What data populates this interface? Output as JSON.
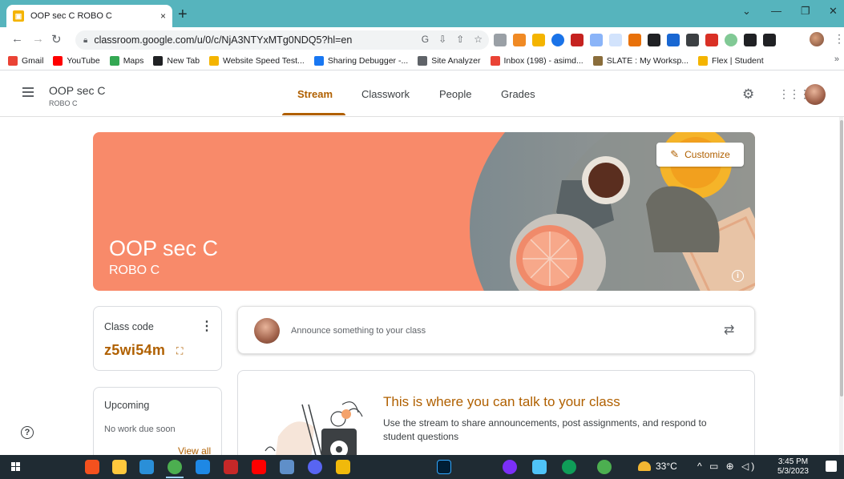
{
  "browser": {
    "tab_title": "OOP sec C ROBO C",
    "tab_close": "×",
    "new_tab": "+",
    "url": "classroom.google.com/u/0/c/NjA3NTYxMTg0NDQ5?hl=en",
    "bookmarks": [
      {
        "label": "Gmail",
        "color": "#ea4335"
      },
      {
        "label": "YouTube",
        "color": "#ff0000"
      },
      {
        "label": "Maps",
        "color": "#34a853"
      },
      {
        "label": "New Tab",
        "color": "#202124"
      },
      {
        "label": "Website Speed Test...",
        "color": "#f4b400"
      },
      {
        "label": "Sharing Debugger -...",
        "color": "#1877f2"
      },
      {
        "label": "Site Analyzer",
        "color": "#5f6368"
      },
      {
        "label": "Inbox (198) - asimd...",
        "color": "#ea4335"
      },
      {
        "label": "SLATE : My Worksp...",
        "color": "#8a6d3b"
      },
      {
        "label": "Flex | Student",
        "color": "#f4b400"
      }
    ],
    "bookmarks_more": "»"
  },
  "header": {
    "class_name": "OOP sec C",
    "section": "ROBO C",
    "tabs": [
      "Stream",
      "Classwork",
      "People",
      "Grades"
    ],
    "active_tab": "Stream"
  },
  "banner": {
    "title": "OOP sec C",
    "subtitle": "ROBO C",
    "customize_label": "Customize",
    "accent": "#f88a6a"
  },
  "class_code": {
    "label": "Class code",
    "value": "z5wi54m"
  },
  "upcoming": {
    "title": "Upcoming",
    "empty_text": "No work due soon",
    "view_all": "View all"
  },
  "announce": {
    "placeholder": "Announce something to your class"
  },
  "talk": {
    "title": "This is where you can talk to your class",
    "description": "Use the stream to share announcements, post assignments, and respond to student questions"
  },
  "taskbar": {
    "temperature": "33°C",
    "time": "3:45 PM",
    "date": "5/3/2023"
  },
  "colors": {
    "accent": "#b06000",
    "tab_strip": "#56b4bd",
    "taskbar": "#1f2b33"
  }
}
